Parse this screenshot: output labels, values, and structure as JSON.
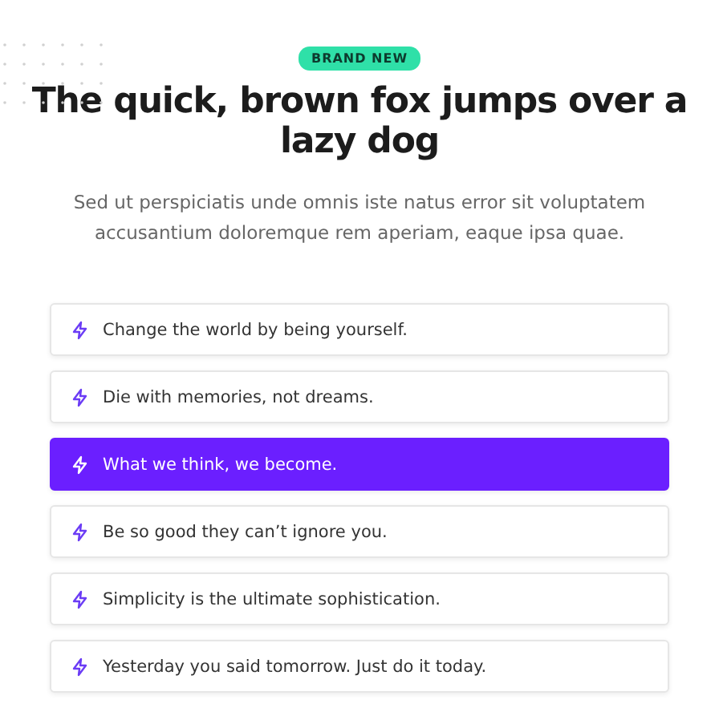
{
  "badge": "BRAND NEW",
  "title": "The quick, brown fox jumps over a lazy dog",
  "description": "Sed ut perspiciatis unde omnis iste natus error sit voluptatem accusantium doloremque rem aperiam, eaque ipsa quae.",
  "items": [
    {
      "label": "Change the world by being yourself.",
      "selected": false
    },
    {
      "label": "Die with memories, not dreams.",
      "selected": false
    },
    {
      "label": "What we think, we become.",
      "selected": true
    },
    {
      "label": "Be so good they can’t ignore you.",
      "selected": false
    },
    {
      "label": "Simplicity is the ultimate sophistication.",
      "selected": false
    },
    {
      "label": "Yesterday you said tomorrow. Just do it today.",
      "selected": false
    }
  ]
}
